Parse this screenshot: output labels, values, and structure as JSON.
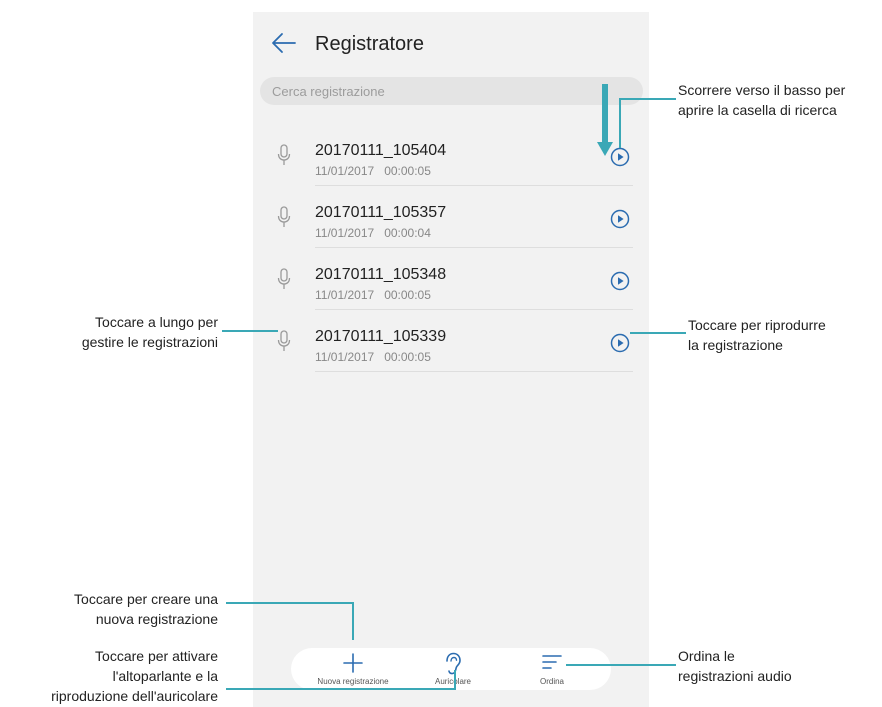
{
  "app": {
    "title": "Registratore"
  },
  "search": {
    "placeholder": "Cerca registrazione"
  },
  "recordings": [
    {
      "name": "20170111_105404",
      "date": "11/01/2017",
      "duration": "00:00:05"
    },
    {
      "name": "20170111_105357",
      "date": "11/01/2017",
      "duration": "00:00:04"
    },
    {
      "name": "20170111_105348",
      "date": "11/01/2017",
      "duration": "00:00:05"
    },
    {
      "name": "20170111_105339",
      "date": "11/01/2017",
      "duration": "00:00:05"
    }
  ],
  "bottom_bar": {
    "new_label": "Nuova registrazione",
    "earpiece_label": "Auricolare",
    "sort_label": "Ordina"
  },
  "annotations": {
    "swipe": "Scorrere verso il basso per\naprire la casella di ricerca",
    "long_press": "Toccare a lungo per\ngestire le registrazioni",
    "play": "Toccare per riprodurre\nla registrazione",
    "new": "Toccare per creare una\nnuova registrazione",
    "earpiece": "Toccare per attivare\nl'altoparlante e la\nriproduzione dell'auricolare",
    "sort": "Ordina le\nregistrazioni audio"
  },
  "colors": {
    "accent": "#3a6ea8",
    "callout": "#3aa8b6"
  }
}
